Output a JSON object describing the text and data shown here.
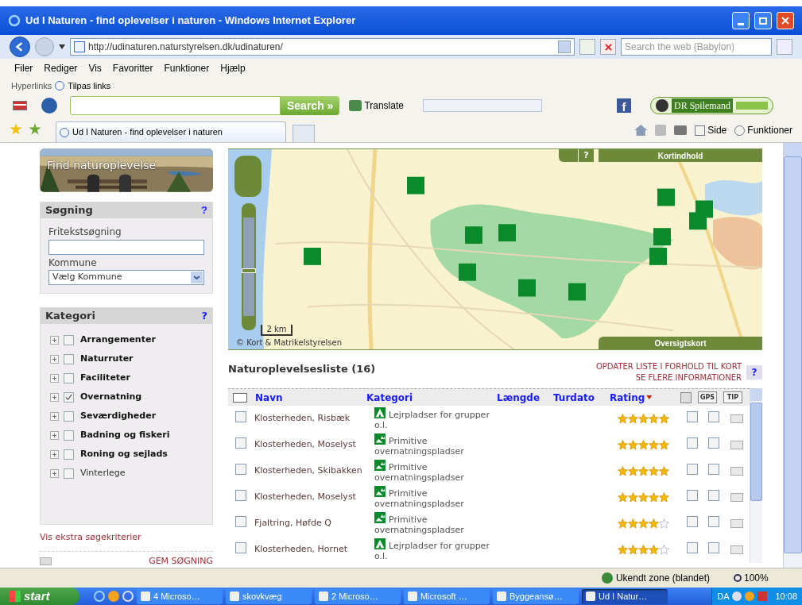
{
  "window": {
    "title": "Ud I Naturen - find oplevelser i naturen - Windows Internet Explorer"
  },
  "address": {
    "value": "http://udinaturen.naturstyrelsen.dk/udinaturen/"
  },
  "web_search": {
    "placeholder": "Search the web (Babylon)"
  },
  "menu": [
    "Filer",
    "Rediger",
    "Vis",
    "Favoritter",
    "Funktioner",
    "Hjælp"
  ],
  "links_bar": {
    "label": "Hyperlinks",
    "link": "Tilpas links"
  },
  "toolbar": {
    "search_button": "Search »",
    "translate": "Translate",
    "facebook": "f",
    "radio": "DR Spilemand"
  },
  "tab": {
    "title": "Ud I Naturen - find oplevelser i naturen"
  },
  "command_bar": [
    "Side",
    "Funktioner"
  ],
  "banner": {
    "title": "Find naturoplevelse"
  },
  "search_panel": {
    "title": "Søgning",
    "help": "?",
    "free_text_label": "Fritekstsøgning",
    "municipality_label": "Kommune",
    "municipality_value": "Vælg Kommune"
  },
  "category_panel": {
    "title": "Kategori",
    "help": "?",
    "items": [
      {
        "label": "Arrangementer",
        "checked": false,
        "bold": true
      },
      {
        "label": "Naturruter",
        "checked": false,
        "bold": true
      },
      {
        "label": "Faciliteter",
        "checked": false,
        "bold": true
      },
      {
        "label": "Overnatning",
        "checked": true,
        "bold": true
      },
      {
        "label": "Seværdigheder",
        "checked": false,
        "bold": true
      },
      {
        "label": "Badning og fiskeri",
        "checked": false,
        "bold": true
      },
      {
        "label": "Roning og sejlads",
        "checked": false,
        "bold": true
      },
      {
        "label": "Vinterlege",
        "checked": false,
        "bold": false
      }
    ]
  },
  "extra_criteria": "Vis ekstra søgekriterier",
  "save_search": "GEM SØGNING",
  "map": {
    "zoom": {
      "level": 0.46
    },
    "toolbar_help": "?",
    "content_title": "Kortindhold",
    "overview_title": "Oversigtskort",
    "scale": "2 km",
    "copyright": "© Kort & Matrikelstyrelsen"
  },
  "list": {
    "title": "Naturoplevelsesliste (16)",
    "update_link": "OPDATER LISTE I FORHOLD TIL KORT",
    "more_link": "SE FLERE INFORMATIONER",
    "help": "?",
    "columns": [
      "Navn",
      "Kategori",
      "Længde",
      "Turdato",
      "Rating"
    ],
    "icon_columns": [
      "GPS",
      "TIP"
    ],
    "rows": [
      {
        "name": "Klosterheden, Risbæk",
        "kind": "group_camp",
        "category": "Lejrpladser for grupper o.l.",
        "stars": 5,
        "selected": false,
        "print": false,
        "gps": false
      },
      {
        "name": "Klosterheden, Moselyst",
        "kind": "primitive",
        "category": "Primitive overnatningspladser",
        "stars": 5,
        "selected": false,
        "print": false,
        "gps": false
      },
      {
        "name": "Klosterheden, Skibakken",
        "kind": "primitive",
        "category": "Primitive overnatningspladser",
        "stars": 5,
        "selected": false,
        "print": false,
        "gps": false
      },
      {
        "name": "Klosterheden, Moselyst",
        "kind": "primitive",
        "category": "Primitive overnatningspladser",
        "stars": 5,
        "selected": false,
        "print": false,
        "gps": false
      },
      {
        "name": "Fjaltring, Høfde Q",
        "kind": "primitive",
        "category": "Primitive overnatningspladser",
        "stars": 4,
        "selected": false,
        "print": false,
        "gps": false
      },
      {
        "name": "Klosterheden, Hornet",
        "kind": "group_camp",
        "category": "Lejrpladser for grupper o.l.",
        "stars": 4,
        "selected": false,
        "print": false,
        "gps": false
      }
    ]
  },
  "status_bar": {
    "zone": "Ukendt zone (blandet)",
    "zoom": "100%"
  },
  "taskbar": {
    "start": "start",
    "tasks": [
      {
        "label": "4 Microso…",
        "selected": false
      },
      {
        "label": "skovkvæg",
        "selected": false
      },
      {
        "label": "2 Microso…",
        "selected": false
      },
      {
        "label": "Microsoft …",
        "selected": false
      },
      {
        "label": "Byggeansø…",
        "selected": false
      },
      {
        "label": "Ud I Natur…",
        "selected": true
      }
    ],
    "language": "DA",
    "clock": "10:08"
  }
}
